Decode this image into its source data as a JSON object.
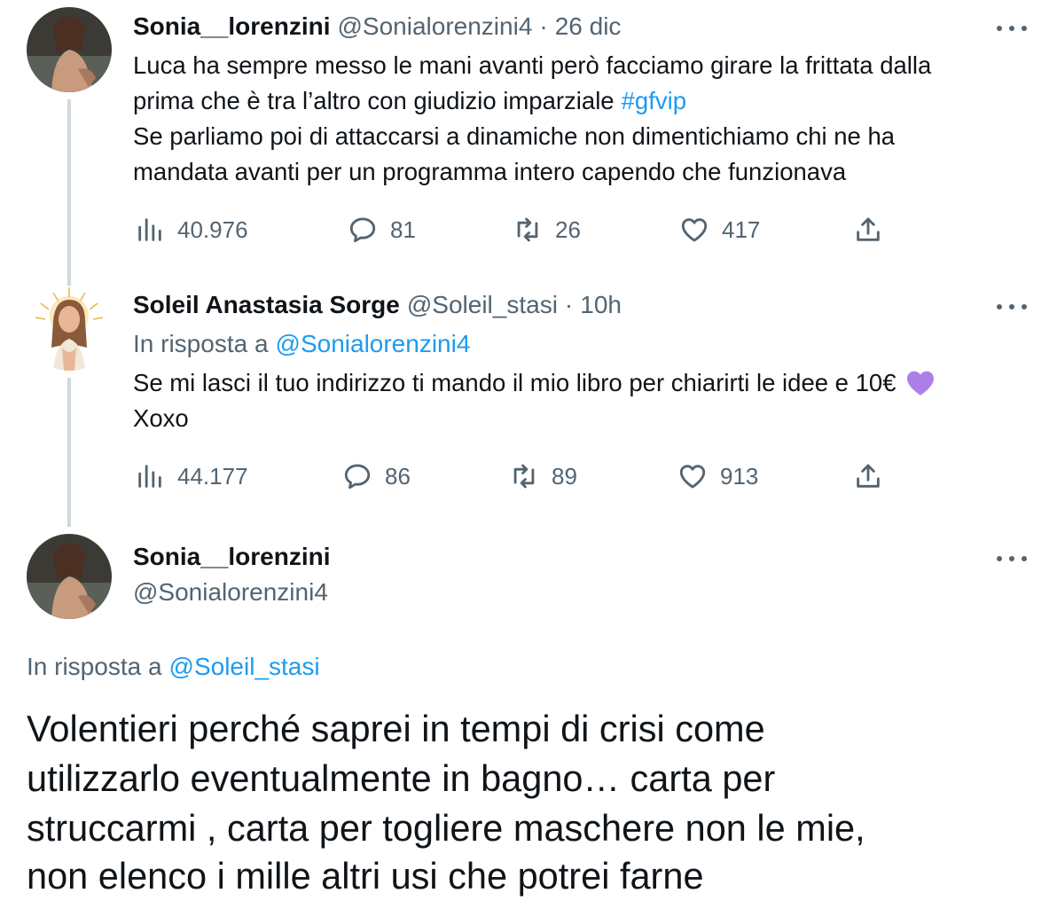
{
  "tweets": [
    {
      "name": "Sonia__lorenzini",
      "handle": "@Sonialorenzini4",
      "sep": "·",
      "time": "26 dic",
      "lines": [
        "Luca ha sempre messo le mani avanti però facciamo girare la frittata dalla",
        "prima che è tra l’altro con giudizio imparziale",
        "Se parliamo poi di attaccarsi a dinamiche non dimentichiamo chi ne ha",
        "mandata avanti per un programma intero capendo che funzionava"
      ],
      "hashtag": "#gfvip",
      "stats": {
        "views": "40.976",
        "replies": "81",
        "retweets": "26",
        "likes": "417"
      }
    },
    {
      "name": "Soleil Anastasia Sorge",
      "handle": "@Soleil_stasi",
      "sep": "·",
      "time": "10h",
      "reply_prefix": "In risposta a",
      "reply_to": "@Sonialorenzini4",
      "lines": [
        "Se mi lasci il tuo indirizzo ti mando il mio libro per chiarirti le idee e 10€",
        "Xoxo"
      ],
      "emoji": "purple-heart",
      "stats": {
        "views": "44.177",
        "replies": "86",
        "retweets": "89",
        "likes": "913"
      }
    },
    {
      "name": "Sonia__lorenzini",
      "handle": "@Sonialorenzini4",
      "reply_prefix": "In risposta a",
      "reply_to": "@Soleil_stasi",
      "lines": [
        "Volentieri perché saprei in tempi di crisi come",
        "utilizzarlo eventualmente in bagno… carta per",
        "struccarmi , carta per togliere maschere non le mie,",
        "non elenco i mille altri usi che potrei farne"
      ]
    }
  ],
  "colors": {
    "link": "#1d9bf0",
    "muted": "#536471",
    "text": "#0f1419",
    "thread": "#cfd9de",
    "heart": "#ab7fe6"
  },
  "icons": [
    "views-icon",
    "reply-icon",
    "retweet-icon",
    "like-icon",
    "share-icon",
    "more-icon"
  ]
}
